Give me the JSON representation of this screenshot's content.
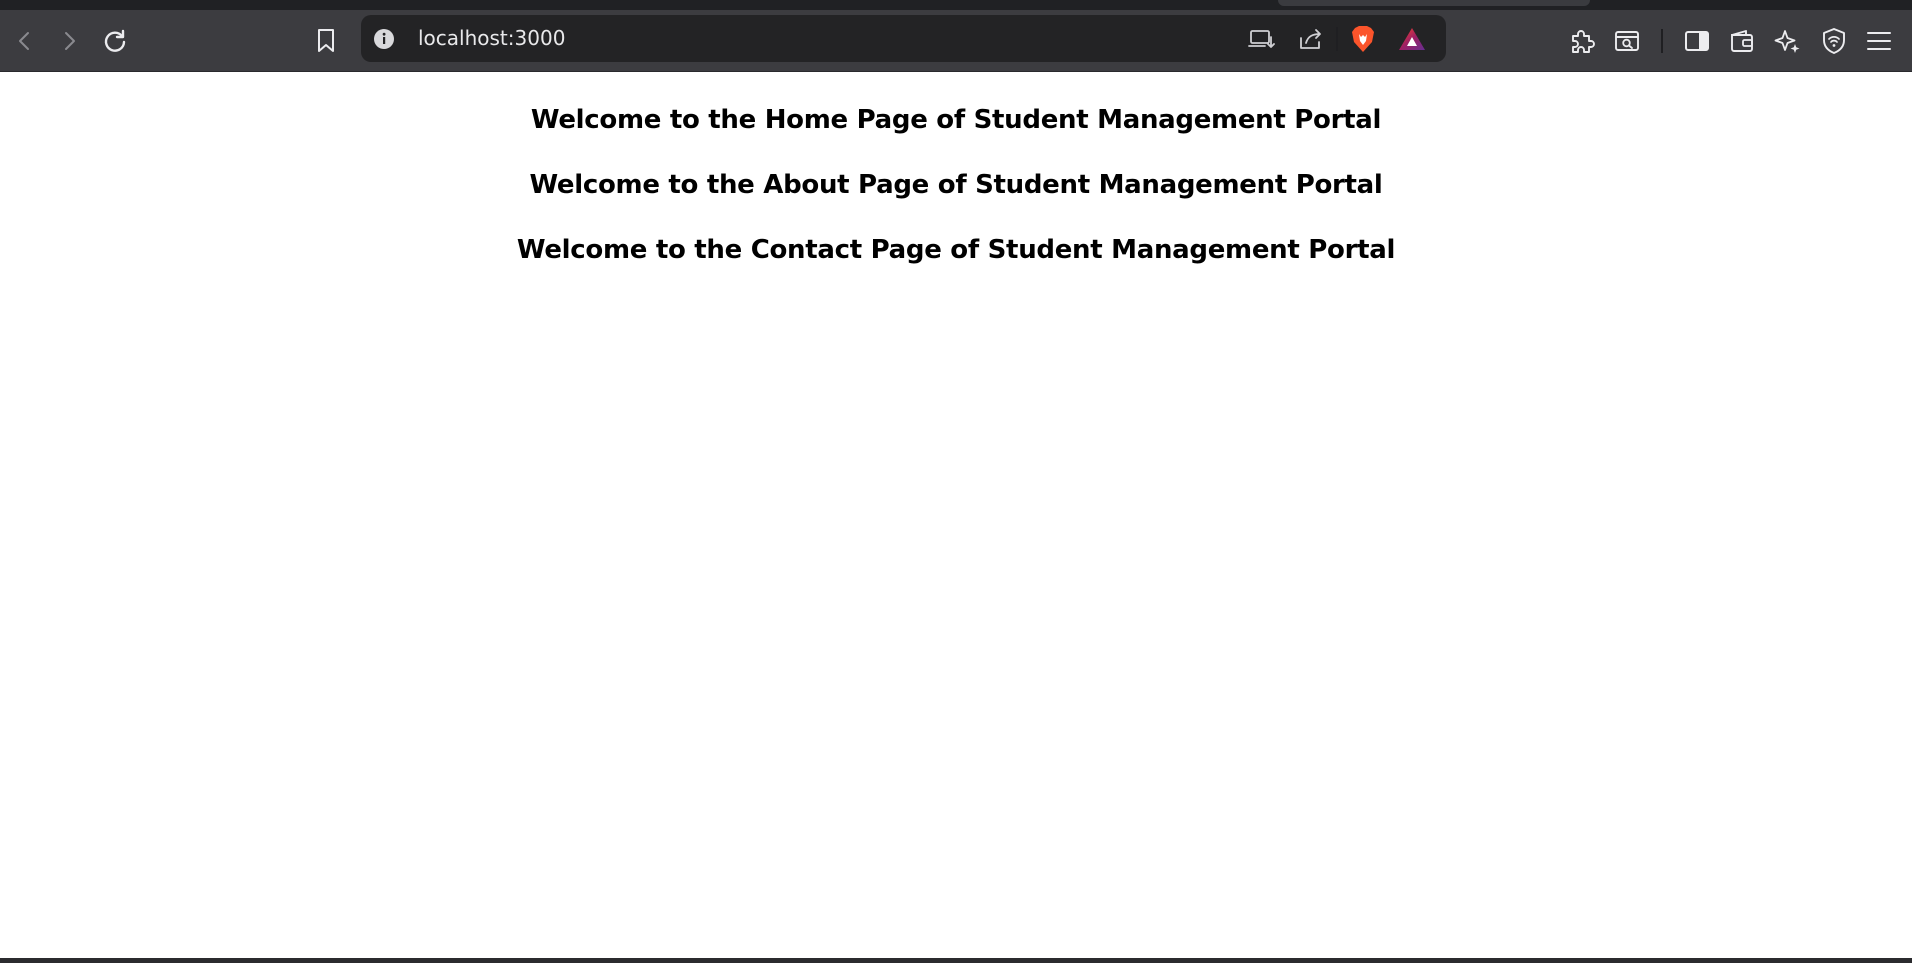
{
  "browser": {
    "url": "localhost:3000",
    "brand_color": "#fb542b",
    "icons": {
      "back": "back-arrow-icon",
      "forward": "forward-arrow-icon",
      "reload": "reload-icon",
      "bookmark": "bookmark-icon",
      "site_info": "info-icon",
      "install": "install-app-icon",
      "share": "share-icon",
      "shields": "brave-shields-icon",
      "rewards": "brave-rewards-icon",
      "extensions": "puzzle-icon",
      "tab_search": "tab-search-icon",
      "sidebar": "sidebar-icon",
      "wallet": "wallet-icon",
      "leo": "sparkle-icon",
      "vpn": "shield-wifi-icon",
      "menu": "hamburger-menu-icon"
    }
  },
  "page": {
    "headings": [
      "Welcome to the Home Page of Student Management Portal",
      "Welcome to the About Page of Student Management Portal",
      "Welcome to the Contact Page of Student Management Portal"
    ]
  }
}
